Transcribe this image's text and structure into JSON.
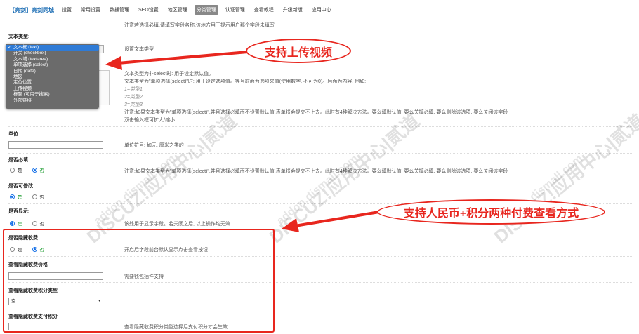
{
  "nav": {
    "brand": "【亮剑】亮剑同城",
    "items": [
      "设置",
      "常用设置",
      "数据管理",
      "SEO设置",
      "地区管理",
      "分类管理",
      "认证管理",
      "查看教程",
      "升级新版",
      "应用中心"
    ],
    "active_index": 5
  },
  "top_note": "注意若选择必填,请填写字段名称,该地方用于提示用户那个字段未填写",
  "text_type": {
    "label": "文本类型:",
    "options": [
      "文本框 (text)",
      "开关 (checkbox)",
      "文本域 (textarea)",
      "单项选择 (select)",
      "日期 (date)",
      "地区",
      "定位位置",
      "上传视频",
      "标题 (可用于搜索)",
      "外部链接"
    ],
    "selected_index": 0,
    "desc": "设置文本类型",
    "desc_lines": [
      "文本类型为非select时: 用于设定默认值。",
      "文本类型为\"单项选择(select)\"时: 用于设定选项值。等号前面为选项来值(使用数字, 不可为0)。后面为内容, 例如:",
      "1=类型1",
      "2=类型2",
      "3=类型3",
      "注意:如果文本类型为\"单项选择(select)\",并且选择必填而不设置默认值,表单将会提交不上去。此时有4种解决方法。要么填默认值, 要么关掉必填, 要么删除该选项, 要么关闭该字段",
      "双击输入框可扩大/缩小"
    ]
  },
  "unit": {
    "label": "单位:",
    "value": "",
    "desc": "单位符号: 如元, 厘米之类的"
  },
  "required": {
    "label": "是否必填:",
    "options": [
      "是",
      "否"
    ],
    "selected_index": 1,
    "desc": "注意:如果文本类型为\"单项选择(select)\",并且选择必填而不设置默认值,表单将会提交不上去。此时有4种解决方法。要么填默认值, 要么关掉必填, 要么删除该选项, 要么关闭该字段"
  },
  "editable": {
    "label": "是否可修改:",
    "options": [
      "是",
      "否"
    ],
    "selected_index": 0
  },
  "visible": {
    "label": "是否显示:",
    "options": [
      "是",
      "否"
    ],
    "selected_index": 0,
    "desc": "该处用于显示字段。若关闭之后, 以上操作均无效"
  },
  "hidden_fee": {
    "label": "是否隐藏收费",
    "options": [
      "是",
      "否"
    ],
    "selected_index": 1,
    "desc": "开启后字段前台默认显示点击查看按钮"
  },
  "hidden_price": {
    "label": "查看隐藏收费价格",
    "value": "",
    "desc": "需要钱包插件支持"
  },
  "points_type": {
    "label": "查看隐藏收费积分类型",
    "value": "空"
  },
  "points_amount": {
    "label": "查看隐藏收费支付积分",
    "value": "",
    "desc": "查看隐藏收费积分类型选择后支付积分才会生效"
  },
  "annotations": {
    "callout1": "支持上传视频",
    "callout2": "支持人民币+积分两种付费查看方式"
  },
  "watermark": {
    "main": "DISCUZ!应用中心|贰道",
    "sub": "addon.dismall.com"
  },
  "colors": {
    "accent": "#1a73e8",
    "annotation_red": "#e8261e",
    "dropdown_bg": "#6b6b6b",
    "dropdown_selected": "#2f7bd6"
  }
}
